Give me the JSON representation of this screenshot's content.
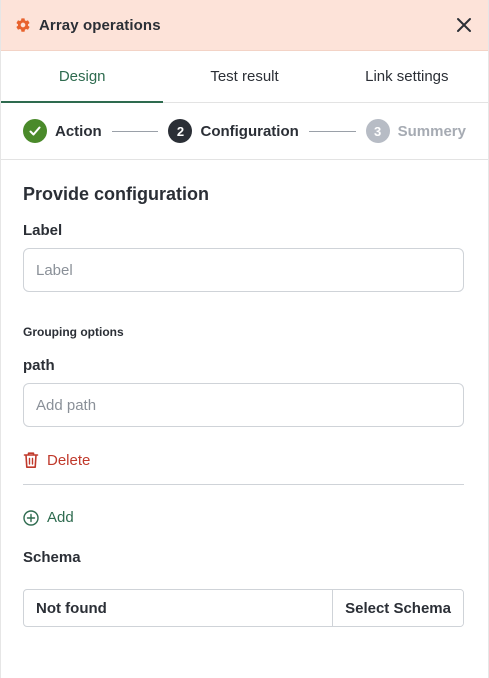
{
  "header": {
    "title": "Array operations",
    "icon": "gear-icon",
    "close_icon": "close-icon",
    "background_color": "#fde3d9",
    "icon_color": "#e8622d"
  },
  "tabs": [
    {
      "label": "Design",
      "active": true
    },
    {
      "label": "Test result",
      "active": false
    },
    {
      "label": "Link settings",
      "active": false
    }
  ],
  "stepper": {
    "steps": [
      {
        "label": "Action",
        "status": "done",
        "marker": "check-icon"
      },
      {
        "label": "Configuration",
        "status": "current",
        "marker": "2"
      },
      {
        "label": "Summery",
        "status": "pending",
        "marker": "3"
      }
    ]
  },
  "form": {
    "section_title": "Provide configuration",
    "label_field": {
      "label": "Label",
      "value": "",
      "placeholder": "Label"
    },
    "grouping_title": "Grouping options",
    "path_field": {
      "label": "path",
      "value": "",
      "placeholder": "Add path"
    },
    "delete_label": "Delete",
    "add_label": "Add",
    "schema": {
      "label": "Schema",
      "value": "Not found",
      "button_label": "Select Schema"
    }
  },
  "colors": {
    "accent_green": "#2e6b4f",
    "done_green": "#4a8a2a",
    "danger_red": "#c0392b"
  }
}
